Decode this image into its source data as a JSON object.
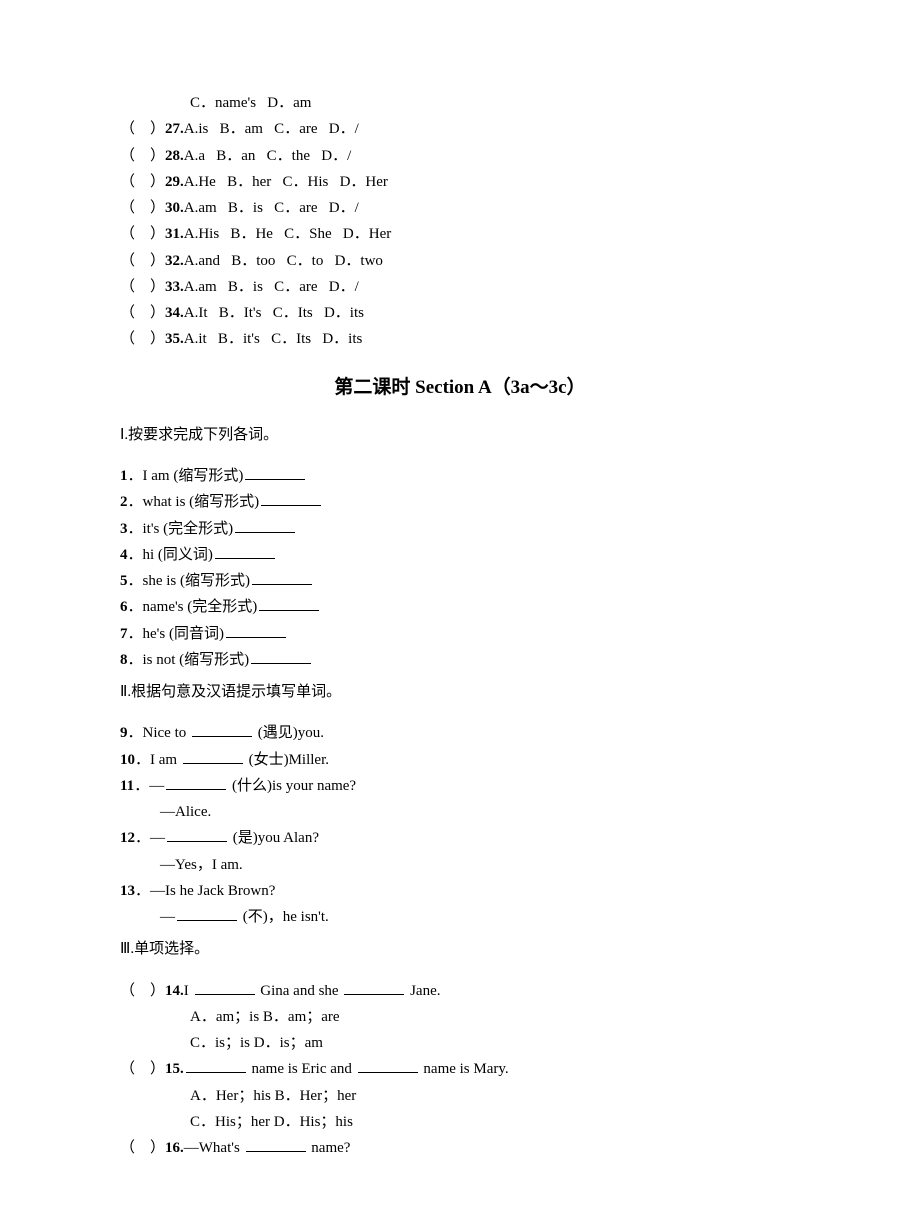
{
  "continued": {
    "line26opts": "C．name's   D．am",
    "mc": [
      {
        "num": "27.",
        "opts": "A.is   B．am   C．are   D．/"
      },
      {
        "num": "28.",
        "opts": "A.a   B．an   C．the   D．/"
      },
      {
        "num": "29.",
        "opts": "A.He   B．her   C．His   D．Her"
      },
      {
        "num": "30.",
        "opts": "A.am   B．is   C．are   D．/"
      },
      {
        "num": "31.",
        "opts": "A.His   B．He   C．She   D．Her"
      },
      {
        "num": "32.",
        "opts": "A.and   B．too   C．to   D．two"
      },
      {
        "num": "33.",
        "opts": "A.am   B．is   C．are   D．/"
      },
      {
        "num": "34.",
        "opts": "A.It   B．It's   C．Its   D．its"
      },
      {
        "num": "35.",
        "opts": "A.it   B．it's   C．Its   D．its"
      }
    ]
  },
  "title": "第二课时 Section A（3a～3c）",
  "sec1": {
    "head": "Ⅰ.按要求完成下列各词。",
    "items": [
      {
        "num": "1",
        "text_pre": "．I am (缩写形式)"
      },
      {
        "num": "2",
        "text_pre": "．what is (缩写形式)"
      },
      {
        "num": "3",
        "text_pre": "．it's (完全形式)"
      },
      {
        "num": "4",
        "text_pre": "．hi (同义词)"
      },
      {
        "num": "5",
        "text_pre": "．she is (缩写形式)"
      },
      {
        "num": "6",
        "text_pre": "．name's (完全形式)"
      },
      {
        "num": "7",
        "text_pre": "．he's (同音词)"
      },
      {
        "num": "8",
        "text_pre": "．is not (缩写形式)"
      }
    ]
  },
  "sec2": {
    "head": "Ⅱ.根据句意及汉语提示填写单词。",
    "q9": {
      "num": "9",
      "pre": "．Nice to ",
      "post": " (遇见)you."
    },
    "q10": {
      "num": "10",
      "pre": "．I am ",
      "post": " (女士)Miller."
    },
    "q11": {
      "num": "11",
      "pre": "．—",
      "post": " (什么)is your name?",
      "ans": "—Alice."
    },
    "q12": {
      "num": "12",
      "pre": "．—",
      "post": " (是)you Alan?",
      "ans": "—Yes，I am."
    },
    "q13": {
      "num": "13",
      "pre": "．—Is he Jack Brown?",
      "sub_pre": "—",
      "sub_post": " (不)，he isn't."
    }
  },
  "sec3": {
    "head": "Ⅲ.单项选择。",
    "q14": {
      "num": "14.",
      "stem_pre": "I ",
      "stem_mid": " Gina and she ",
      "stem_post": " Jane.",
      "optsA": "A．am；is   B．am；are",
      "optsB": "C．is；is   D．is；am"
    },
    "q15": {
      "num": "15.",
      "stem_mid": " name is Eric and ",
      "stem_post": " name is Mary.",
      "optsA": "A．Her；his   B．Her；her",
      "optsB": "C．His；her   D．His；his"
    },
    "q16": {
      "num": "16.",
      "stem_pre": "—What's ",
      "stem_post": " name?"
    }
  }
}
